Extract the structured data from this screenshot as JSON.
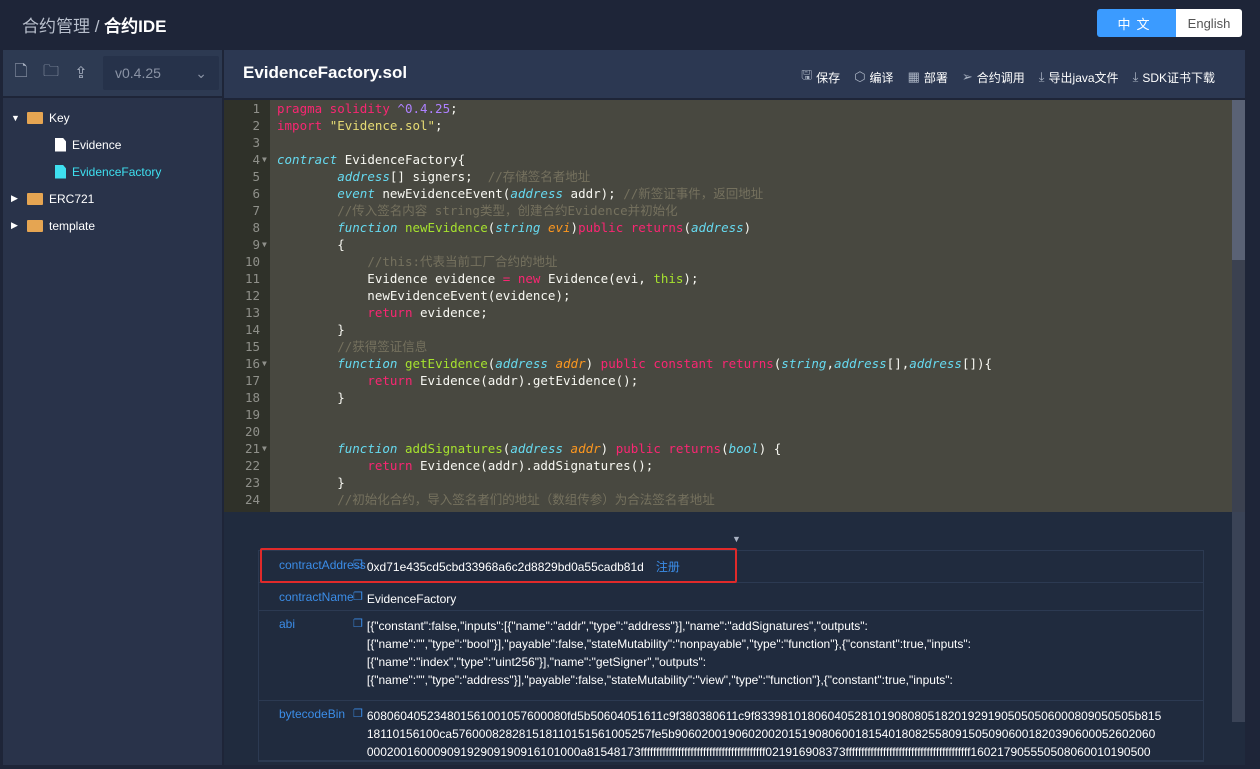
{
  "header": {
    "breadcrumb_parent": "合约管理",
    "breadcrumb_sep": " / ",
    "breadcrumb_current": "合约IDE",
    "lang_zh": "中文",
    "lang_en": "English"
  },
  "sidebar": {
    "version": "v0.4.25",
    "tools": [
      "new-file-icon",
      "new-folder-icon",
      "upload-icon"
    ],
    "tree": [
      {
        "label": "Key",
        "type": "folder",
        "open": true
      },
      {
        "label": "Evidence",
        "type": "file"
      },
      {
        "label": "EvidenceFactory",
        "type": "file",
        "active": true
      },
      {
        "label": "ERC721",
        "type": "folder"
      },
      {
        "label": "template",
        "type": "folder"
      }
    ]
  },
  "editor": {
    "filename": "EvidenceFactory.sol",
    "actions": [
      {
        "icon": "save-icon",
        "label": "保存"
      },
      {
        "icon": "compile-icon",
        "label": "编译"
      },
      {
        "icon": "deploy-icon",
        "label": "部署"
      },
      {
        "icon": "send-icon",
        "label": "合约调用"
      },
      {
        "icon": "download-icon",
        "label": "导出java文件"
      },
      {
        "icon": "download-icon",
        "label": "SDK证书下载"
      }
    ],
    "lines": [
      [
        [
          "kw",
          "pragma solidity "
        ],
        [
          "num",
          "^0.4.25"
        ],
        [
          "",
          "; "
        ]
      ],
      [
        [
          "kw",
          "import "
        ],
        [
          "str",
          "\"Evidence.sol\""
        ],
        [
          "",
          ";"
        ]
      ],
      [],
      [
        [
          "ty",
          "contract"
        ],
        [
          "",
          " EvidenceFactory{"
        ]
      ],
      [
        [
          "",
          "        "
        ],
        [
          "ty",
          "address"
        ],
        [
          "",
          "[] signers;  "
        ],
        [
          "cm",
          "//存储签名者地址"
        ]
      ],
      [
        [
          "",
          "        "
        ],
        [
          "ty",
          "event"
        ],
        [
          "",
          " newEvidenceEvent("
        ],
        [
          "ty",
          "address"
        ],
        [
          "",
          " addr); "
        ],
        [
          "cm",
          "//新签证事件，返回地址"
        ]
      ],
      [
        [
          "",
          "        "
        ],
        [
          "cm",
          "//传入签名内容 string类型，创建合约Evidence并初始化"
        ]
      ],
      [
        [
          "",
          "        "
        ],
        [
          "ty",
          "function"
        ],
        [
          "fn",
          " newEvidence"
        ],
        [
          "",
          "("
        ],
        [
          "ty",
          "string"
        ],
        [
          "pa",
          " evi"
        ],
        [
          "",
          ")"
        ],
        [
          "kw",
          "public returns"
        ],
        [
          "",
          "("
        ],
        [
          "ty",
          "address"
        ],
        [
          "",
          ")"
        ]
      ],
      [
        [
          "",
          "        {"
        ]
      ],
      [
        [
          "",
          "            "
        ],
        [
          "cm",
          "//this:代表当前工厂合约的地址"
        ]
      ],
      [
        [
          "",
          "            Evidence evidence "
        ],
        [
          "kw",
          "="
        ],
        [
          "kw",
          " new"
        ],
        [
          "",
          " Evidence(evi, "
        ],
        [
          "th",
          "this"
        ],
        [
          "",
          ");"
        ]
      ],
      [
        [
          "",
          "            newEvidenceEvent(evidence);"
        ]
      ],
      [
        [
          "",
          "            "
        ],
        [
          "kw",
          "return"
        ],
        [
          "",
          " evidence;"
        ]
      ],
      [
        [
          "",
          "        }"
        ]
      ],
      [
        [
          "",
          "        "
        ],
        [
          "cm",
          "//获得签证信息"
        ]
      ],
      [
        [
          "",
          "        "
        ],
        [
          "ty",
          "function"
        ],
        [
          "fn",
          " getEvidence"
        ],
        [
          "",
          "("
        ],
        [
          "ty",
          "address"
        ],
        [
          "pa",
          " addr"
        ],
        [
          "",
          ") "
        ],
        [
          "kw",
          "public constant returns"
        ],
        [
          "",
          "("
        ],
        [
          "ty",
          "string"
        ],
        [
          "",
          ","
        ],
        [
          "ty",
          "address"
        ],
        [
          "",
          "[],"
        ],
        [
          "ty",
          "address"
        ],
        [
          "",
          "[]){"
        ]
      ],
      [
        [
          "",
          "            "
        ],
        [
          "kw",
          "return"
        ],
        [
          "",
          " Evidence(addr).getEvidence();"
        ]
      ],
      [
        [
          "",
          "        }"
        ]
      ],
      [],
      [],
      [
        [
          "",
          "        "
        ],
        [
          "ty",
          "function"
        ],
        [
          "fn",
          " addSignatures"
        ],
        [
          "",
          "("
        ],
        [
          "ty",
          "address"
        ],
        [
          "pa",
          " addr"
        ],
        [
          "",
          ") "
        ],
        [
          "kw",
          "public returns"
        ],
        [
          "",
          "("
        ],
        [
          "ty",
          "bool"
        ],
        [
          "",
          ") {"
        ]
      ],
      [
        [
          "",
          "            "
        ],
        [
          "kw",
          "return"
        ],
        [
          "",
          " Evidence(addr).addSignatures();"
        ]
      ],
      [
        [
          "",
          "        }"
        ]
      ],
      [
        [
          "",
          "        "
        ],
        [
          "cm",
          "//初始化合约，导入签名者们的地址（数组传参）为合法签名者地址"
        ]
      ]
    ],
    "fold_lines": [
      4,
      9,
      16,
      21
    ]
  },
  "result": {
    "rows": [
      {
        "key": "contractAddress",
        "value": [
          "0xd71e435cd5cbd33968a6c2d8829bd0a55cadb81d"
        ],
        "link": "注册"
      },
      {
        "key": "contractName",
        "value": [
          "EvidenceFactory"
        ]
      },
      {
        "key": "abi",
        "value": [
          "[{\"constant\":false,\"inputs\":[{\"name\":\"addr\",\"type\":\"address\"}],\"name\":\"addSignatures\",\"outputs\":",
          "[{\"name\":\"\",\"type\":\"bool\"}],\"payable\":false,\"stateMutability\":\"nonpayable\",\"type\":\"function\"},{\"constant\":true,\"inputs\":",
          "[{\"name\":\"index\",\"type\":\"uint256\"}],\"name\":\"getSigner\",\"outputs\":",
          "[{\"name\":\"\",\"type\":\"address\"}],\"payable\":false,\"stateMutability\":\"view\",\"type\":\"function\"},{\"constant\":true,\"inputs\":"
        ]
      },
      {
        "key": "bytecodeBin",
        "value": [
          "608060405234801561001057600080fd5b50604051611c9f380380611c9f833981018060405281019080805182019291905050506000809050505b815",
          "18110156100ca576000828281518110151561005257fe5b906020019060200201519080600181540180825580915050906001820390600052602060",
          "00020016000909192909190916101000a81548173ffffffffffffffffffffffffffffffffffffffff021916908373ffffffffffffffffffffffffffffffffffffffff160217905550508060010190500"
        ]
      }
    ]
  },
  "colors": {
    "accent": "#3b9bff",
    "link": "#3b8de8",
    "highlight_box": "#e02a2a",
    "folder": "#e5a552",
    "active_file": "#3ee0f0"
  }
}
